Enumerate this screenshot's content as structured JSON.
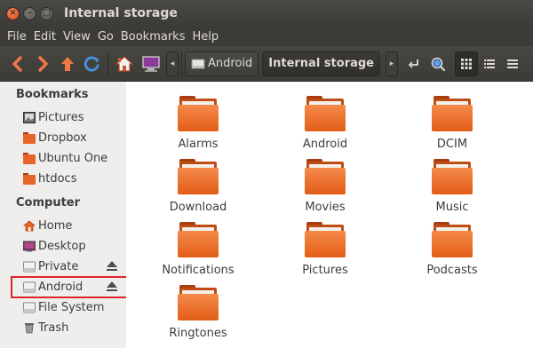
{
  "window": {
    "title": "Internal storage",
    "close_glyph": "×",
    "min_glyph": "–",
    "max_glyph": "□"
  },
  "menubar": [
    "File",
    "Edit",
    "View",
    "Go",
    "Bookmarks",
    "Help"
  ],
  "toolbar": {
    "breadcrumbs": [
      {
        "label": "Android",
        "active": false
      },
      {
        "label": "Internal storage",
        "active": true
      }
    ]
  },
  "sidebar": {
    "sections": [
      {
        "heading": "Bookmarks",
        "items": [
          {
            "label": "Pictures",
            "icon": "pictures-icon"
          },
          {
            "label": "Dropbox",
            "icon": "folder-icon"
          },
          {
            "label": "Ubuntu One",
            "icon": "folder-icon"
          },
          {
            "label": "htdocs",
            "icon": "folder-icon"
          }
        ]
      },
      {
        "heading": "Computer",
        "items": [
          {
            "label": "Home",
            "icon": "home-icon"
          },
          {
            "label": "Desktop",
            "icon": "desktop-icon"
          },
          {
            "label": "Private",
            "icon": "drive-icon",
            "eject": true
          },
          {
            "label": "Android",
            "icon": "drive-icon",
            "eject": true,
            "highlighted": true
          },
          {
            "label": "File System",
            "icon": "drive-icon"
          },
          {
            "label": "Trash",
            "icon": "trash-icon"
          }
        ]
      }
    ]
  },
  "folders": [
    "Alarms",
    "Android",
    "DCIM",
    "Download",
    "Movies",
    "Music",
    "Notifications",
    "Pictures",
    "Podcasts",
    "Ringtones"
  ],
  "colors": {
    "accent_orange": "#e25d16",
    "highlight_red": "#e0252a",
    "nav_arrow_orange": "#f07746",
    "refresh_blue": "#4a8fd8"
  }
}
